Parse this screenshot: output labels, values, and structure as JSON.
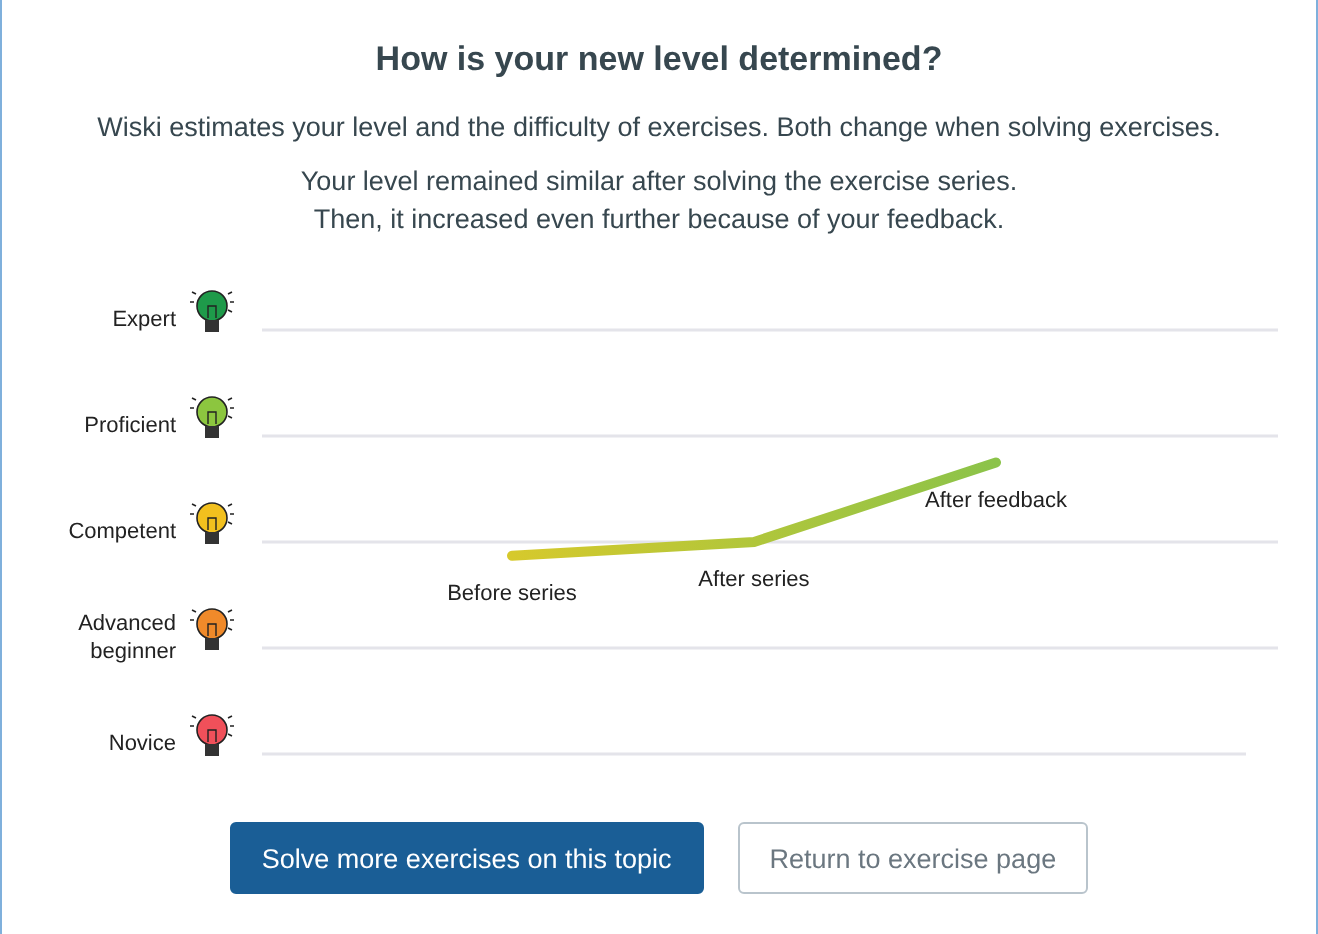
{
  "title": "How is your new level determined?",
  "intro": "Wiski estimates your level and the difficulty of exercises. Both change when solving exercises.",
  "explanation": [
    "Your level remained similar after solving the exercise series.",
    "Then, it increased even further because of your feedback."
  ],
  "levels": [
    {
      "label": "Expert",
      "color": "#1e9a4a"
    },
    {
      "label": "Proficient",
      "color": "#8cc63f"
    },
    {
      "label": "Competent",
      "color": "#f2c01e"
    },
    {
      "label": "Advanced beginner",
      "color": "#f08a2a"
    },
    {
      "label": "Novice",
      "color": "#f0505a"
    }
  ],
  "point_labels": [
    "Before series",
    "After series",
    "After feedback"
  ],
  "buttons": [
    {
      "label": "Solve more exercises on this topic",
      "kind": "primary"
    },
    {
      "label": "Return to exercise page",
      "kind": "secondary"
    }
  ]
}
